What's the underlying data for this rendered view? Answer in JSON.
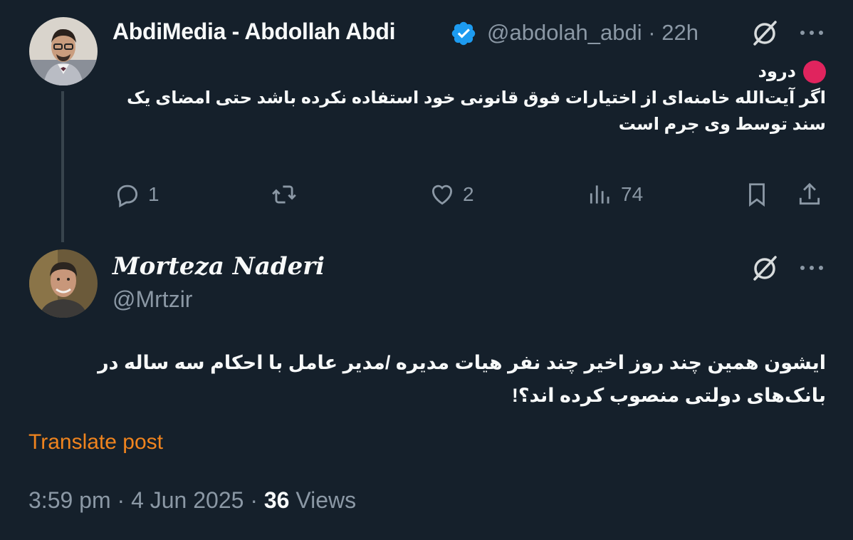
{
  "tweet1": {
    "author_name": "AbdiMedia - Abdollah Abdi",
    "handle": "@abdolah_abdi",
    "separator": "·",
    "time": "22h",
    "greeting": "درود",
    "body": "اگر آیت‌الله خامنه‌ای از اختیارات فوق قانونی خود استفاده نکرده باشد حتی امضای یک سند توسط وی جرم است",
    "replies": "1",
    "likes": "2",
    "views": "74"
  },
  "tweet2": {
    "author_name": "Morteza Naderi",
    "handle": "@Mrtzir",
    "body": "ایشون همین چند روز اخیر چند نفر هیات مدیره /مدیر عامل  با احکام  سه ساله در بانک‌های دولتی منصوب کرده اند؟!",
    "translate_label": "Translate post",
    "time": "3:59 pm",
    "date": "4 Jun 2025",
    "views_count": "36",
    "views_label": "Views"
  },
  "colors": {
    "background": "#15202b",
    "text": "#f7f9f9",
    "muted": "#8b98a5",
    "verified": "#1d9bf0",
    "translate": "#f0841e",
    "greeting_dot": "#e0245e"
  }
}
